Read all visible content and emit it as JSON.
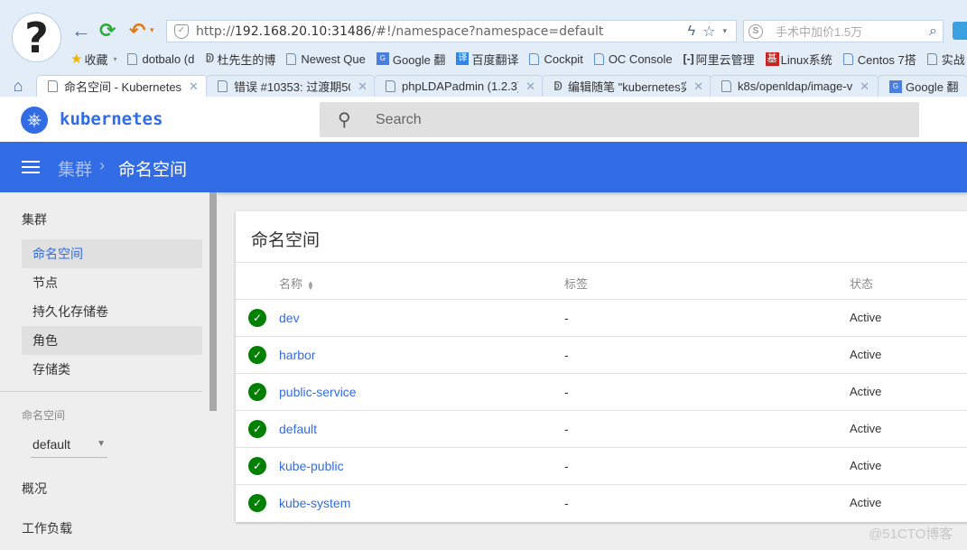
{
  "browser": {
    "nav": {
      "back": "←",
      "refresh": "⟳",
      "undo": "↶",
      "undo_caret": "▾"
    },
    "address": {
      "scheme": "http://",
      "host": "192.168.20.10:31486",
      "path": "/#!/namespace?namespace=default"
    },
    "address_icons": {
      "lightning": "ϟ",
      "star": "☆",
      "caret": "▾"
    },
    "search": {
      "logo": "S",
      "placeholder": "手术中加价1.5万",
      "icon": "⌕"
    },
    "bookmarks": [
      {
        "label": "收藏",
        "icon": "star-icon"
      },
      {
        "label": "dotbalo (d",
        "icon": "page-icon"
      },
      {
        "label": "杜先生的博",
        "icon": "blog-icon"
      },
      {
        "label": "Newest Que",
        "icon": "page-icon"
      },
      {
        "label": "Google 翻",
        "icon": "google-translate-icon"
      },
      {
        "label": "百度翻译",
        "icon": "baidu-translate-icon"
      },
      {
        "label": "Cockpit",
        "icon": "page-icon"
      },
      {
        "label": "OC Console",
        "icon": "page-icon"
      },
      {
        "label": "阿里云管理",
        "icon": "aliyun-icon"
      },
      {
        "label": "Linux系统",
        "icon": "ji-icon"
      },
      {
        "label": "Centos 7搭",
        "icon": "page-icon"
      },
      {
        "label": "实战",
        "icon": "page-icon"
      }
    ],
    "tabs": [
      {
        "title": "命名空间 - Kubernetes",
        "active": true
      },
      {
        "title": "错误 #10353: 过渡期50(",
        "active": false
      },
      {
        "title": "phpLDAPadmin (1.2.3)",
        "active": false
      },
      {
        "title": "编辑随笔 \"kubernetes实",
        "active": false
      },
      {
        "title": "k8s/openldap/image-v",
        "active": false
      },
      {
        "title": "Google 翻",
        "active": false
      }
    ]
  },
  "app": {
    "brand": "kubernetes",
    "search_placeholder": "Search",
    "breadcrumb": {
      "parent": "集群",
      "separator": "›",
      "current": "命名空间"
    },
    "colors": {
      "primary": "#326ce5",
      "success": "#008000"
    }
  },
  "sidebar": {
    "cluster_heading": "集群",
    "cluster_items": [
      {
        "label": "命名空间",
        "state": "selected"
      },
      {
        "label": "节点",
        "state": ""
      },
      {
        "label": "持久化存储卷",
        "state": ""
      },
      {
        "label": "角色",
        "state": "hover"
      },
      {
        "label": "存储类",
        "state": ""
      }
    ],
    "namespace_label": "命名空间",
    "namespace_value": "default",
    "overview": "概况",
    "workloads": "工作负载"
  },
  "main": {
    "title": "命名空间",
    "columns": {
      "name": "名称",
      "labels": "标签",
      "status": "状态"
    },
    "rows": [
      {
        "name": "dev",
        "labels": "-",
        "status": "Active"
      },
      {
        "name": "harbor",
        "labels": "-",
        "status": "Active"
      },
      {
        "name": "public-service",
        "labels": "-",
        "status": "Active"
      },
      {
        "name": "default",
        "labels": "-",
        "status": "Active"
      },
      {
        "name": "kube-public",
        "labels": "-",
        "status": "Active"
      },
      {
        "name": "kube-system",
        "labels": "-",
        "status": "Active"
      }
    ]
  },
  "watermark": "@51CTO博客"
}
